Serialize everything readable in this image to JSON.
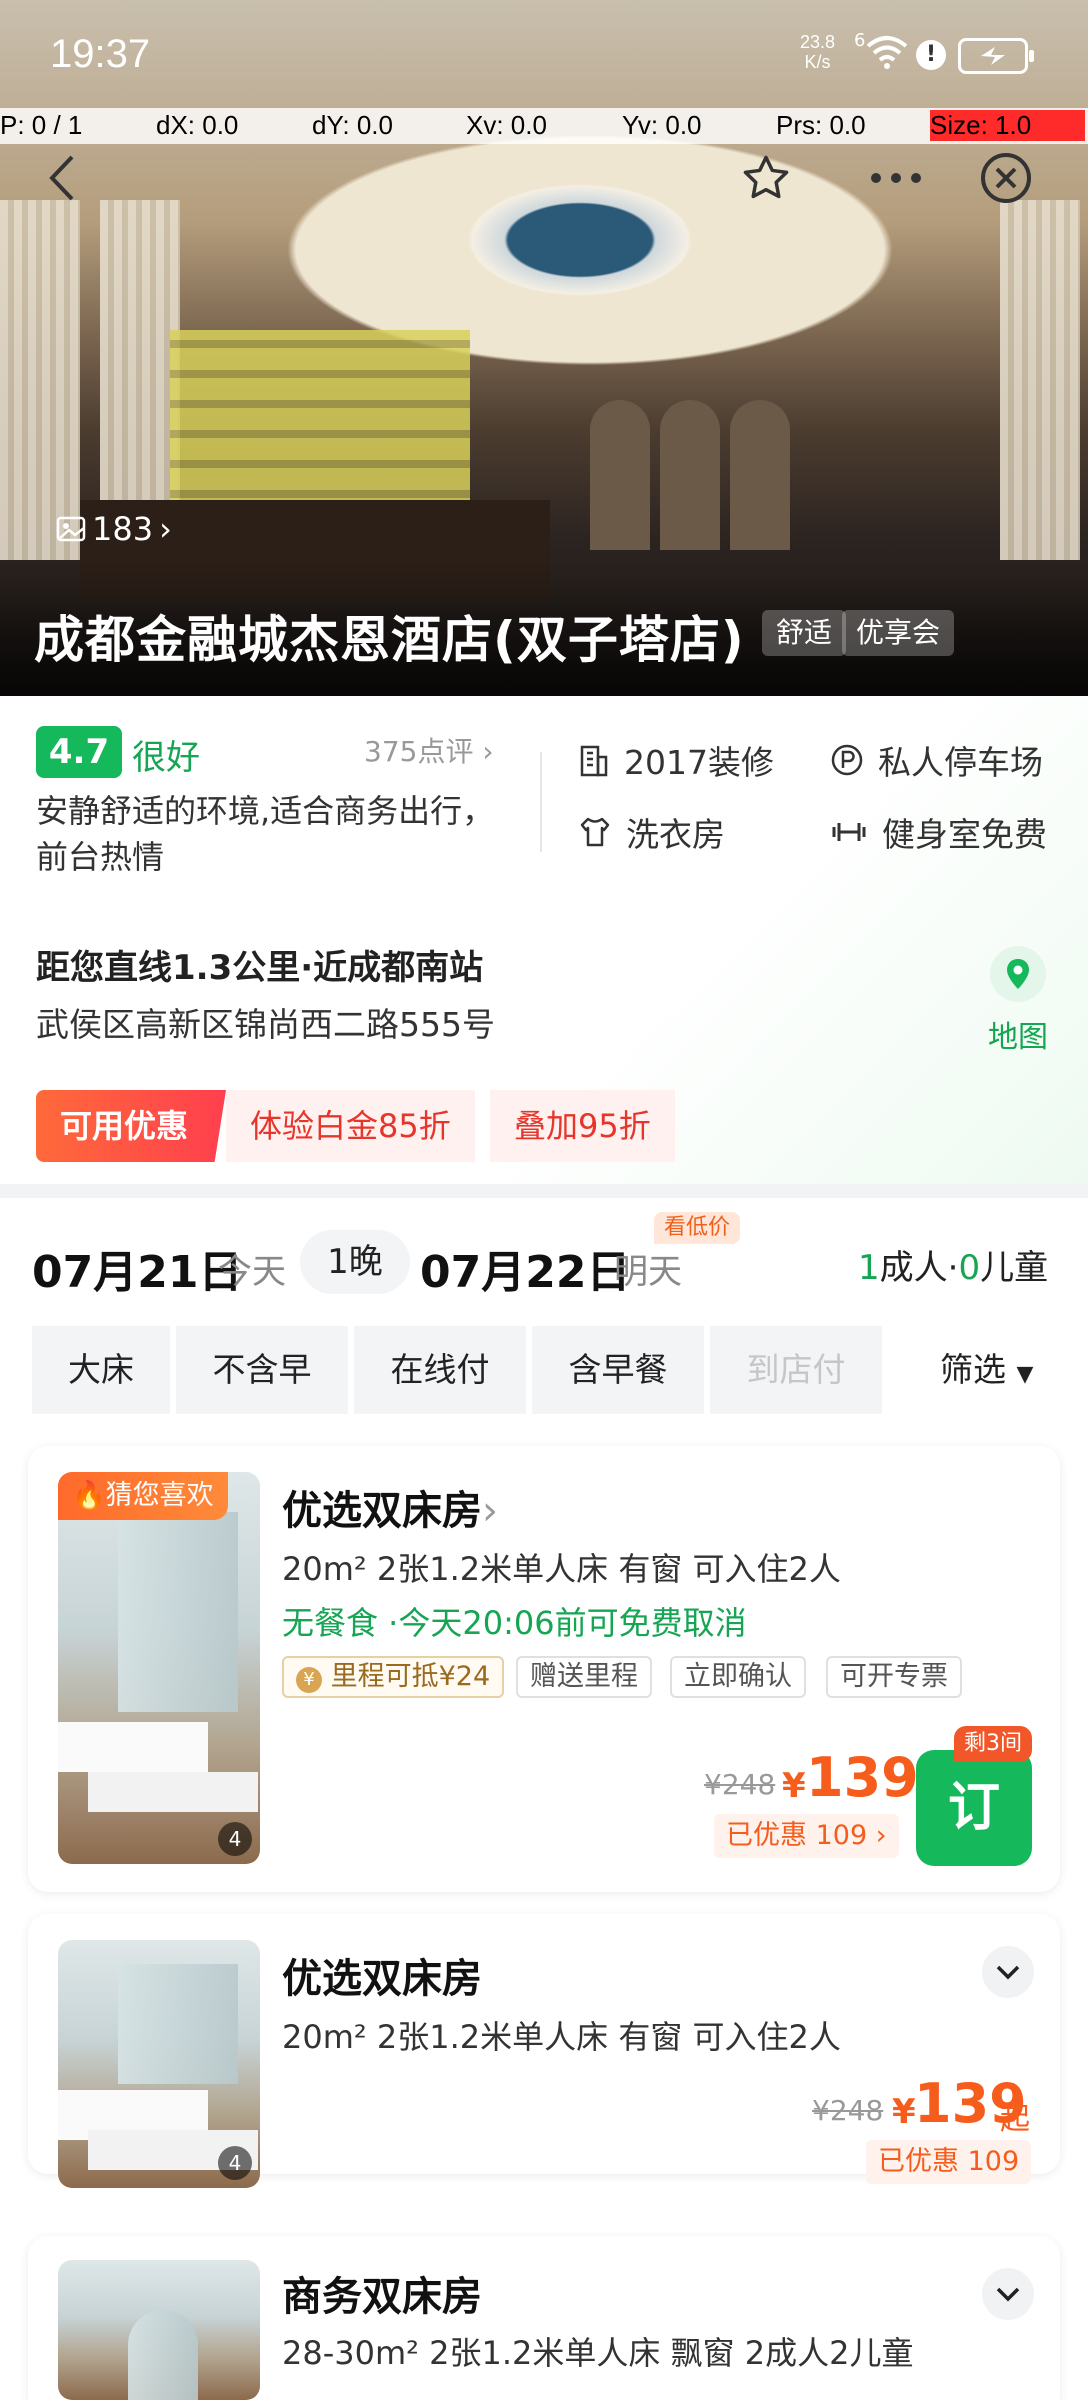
{
  "status_bar": {
    "time": "19:37",
    "net_speed_value": "23.8",
    "net_speed_unit": "K/s",
    "signal": "6"
  },
  "debug": {
    "pointer": "P: 0 / 1",
    "dx": "dX: 0.0",
    "dy": "dY: 0.0",
    "xv": "Xv: 0.0",
    "yv": "Yv: 0.0",
    "prs": "Prs: 0.0",
    "size": "Size: 1.0"
  },
  "hero": {
    "photo_count": "183",
    "hotel_name": "成都金融城杰恩酒店(双子塔店)",
    "tags": [
      "舒适",
      "优享会"
    ]
  },
  "rating": {
    "score": "4.7",
    "label": "很好",
    "reviews": "375点评",
    "summary": "安静舒适的环境,适合商务出行，前台热情"
  },
  "facilities": [
    {
      "label": "2017装修",
      "icon": "building-icon"
    },
    {
      "label": "私人停车场",
      "icon": "parking-icon"
    },
    {
      "label": "洗衣房",
      "icon": "laundry-icon"
    },
    {
      "label": "健身室免费",
      "icon": "dumbbell-icon"
    }
  ],
  "location": {
    "distance": "距您直线1.3公里·近成都南站",
    "address": "武侯区高新区锦尚西二路555号",
    "map_label": "地图"
  },
  "promos": {
    "main": "可用优惠",
    "items": [
      "体验白金85折",
      "叠加95折"
    ]
  },
  "stay": {
    "checkin_date": "07月21日",
    "checkin_day": "今天",
    "nights": "1晚",
    "checkout_date": "07月22日",
    "checkout_day": "明天",
    "low_price_tag": "看低价",
    "adults_num": "1",
    "adults_label": "成人·",
    "children_num": "0",
    "children_label": "儿童"
  },
  "filters": {
    "items": [
      "大床",
      "不含早",
      "在线付",
      "含早餐",
      "到店付"
    ],
    "more": "筛选"
  },
  "rooms": [
    {
      "badge": "猜您喜欢",
      "name": "优选双床房",
      "spec": "20m²  2张1.2米单人床  有窗  可入住2人",
      "policy": "无餐食 ·今天20:06前可免费取消",
      "chips": [
        "里程可抵¥24",
        "赠送里程",
        "立即确认",
        "可开专票"
      ],
      "old_price": "¥248",
      "currency": "¥",
      "price": "139",
      "saved": "已优惠 109",
      "left": "剩3间",
      "book": "订",
      "photo_count": "4"
    },
    {
      "name": "优选双床房",
      "spec": "20m²  2张1.2米单人床  有窗  可入住2人",
      "old_price": "¥248",
      "currency": "¥",
      "price": "139",
      "price_suffix": "起",
      "saved": "已优惠 109",
      "photo_count": "4"
    },
    {
      "name": "商务双床房",
      "spec": "28-30m²  2张1.2米单人床  飘窗  2成人2儿童"
    }
  ]
}
